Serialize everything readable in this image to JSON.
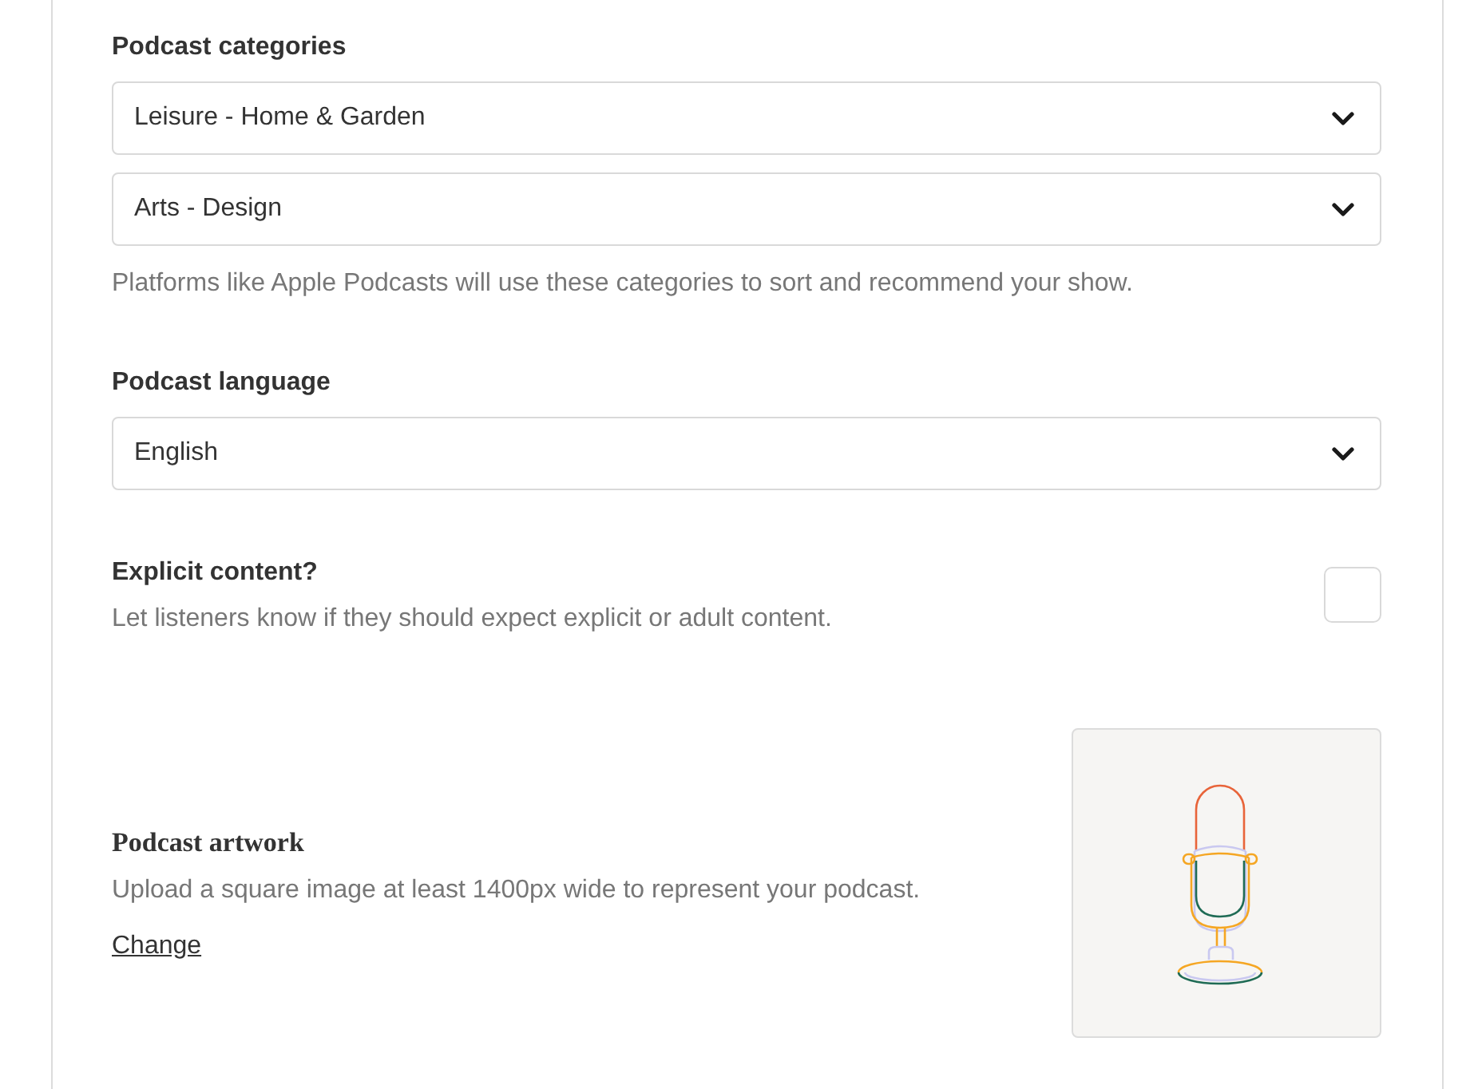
{
  "categories": {
    "label": "Podcast categories",
    "selects": [
      {
        "value": "Leisure - Home & Garden"
      },
      {
        "value": "Arts - Design"
      }
    ],
    "help": "Platforms like Apple Podcasts will use these categories to sort and recommend your show."
  },
  "language": {
    "label": "Podcast language",
    "select": {
      "value": "English"
    }
  },
  "explicit": {
    "label": "Explicit content?",
    "description": "Let listeners know if they should expect explicit or adult content.",
    "checked": false
  },
  "artwork": {
    "title": "Podcast artwork",
    "description": "Upload a square image at least 1400px wide to represent your podcast.",
    "link": "Change"
  }
}
